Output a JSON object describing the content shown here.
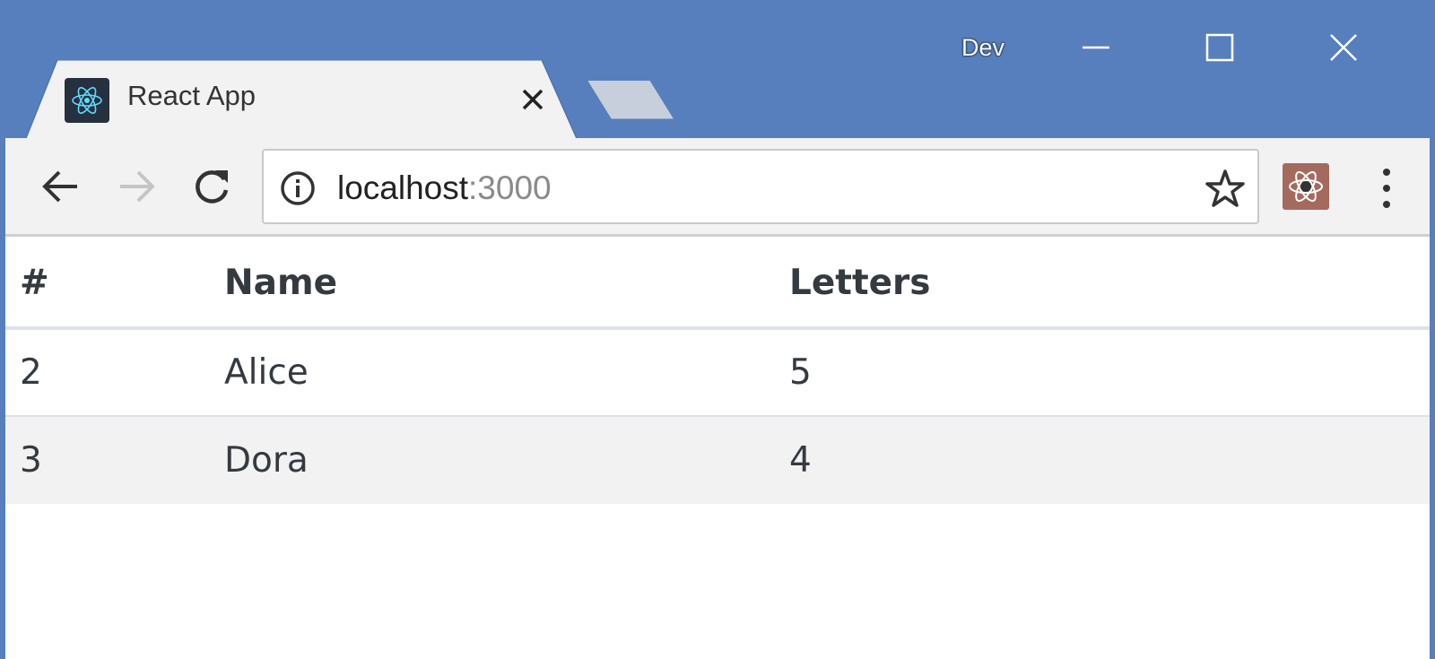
{
  "window": {
    "profile_label": "Dev",
    "accent_color": "#577fbd"
  },
  "tab": {
    "title": "React App",
    "favicon": "react-logo-icon"
  },
  "toolbar": {
    "back_icon": "arrow-left-icon",
    "forward_icon": "arrow-right-icon",
    "reload_icon": "reload-icon",
    "omnibox": {
      "host": "localhost",
      "port": ":3000",
      "info_icon": "info-icon",
      "bookmark_icon": "star-icon"
    },
    "extension_icon": "react-devtools-icon",
    "menu_icon": "three-dots-vertical-icon"
  },
  "table": {
    "headers": [
      "#",
      "Name",
      "Letters"
    ],
    "rows": [
      [
        "2",
        "Alice",
        "5"
      ],
      [
        "3",
        "Dora",
        "4"
      ]
    ]
  }
}
